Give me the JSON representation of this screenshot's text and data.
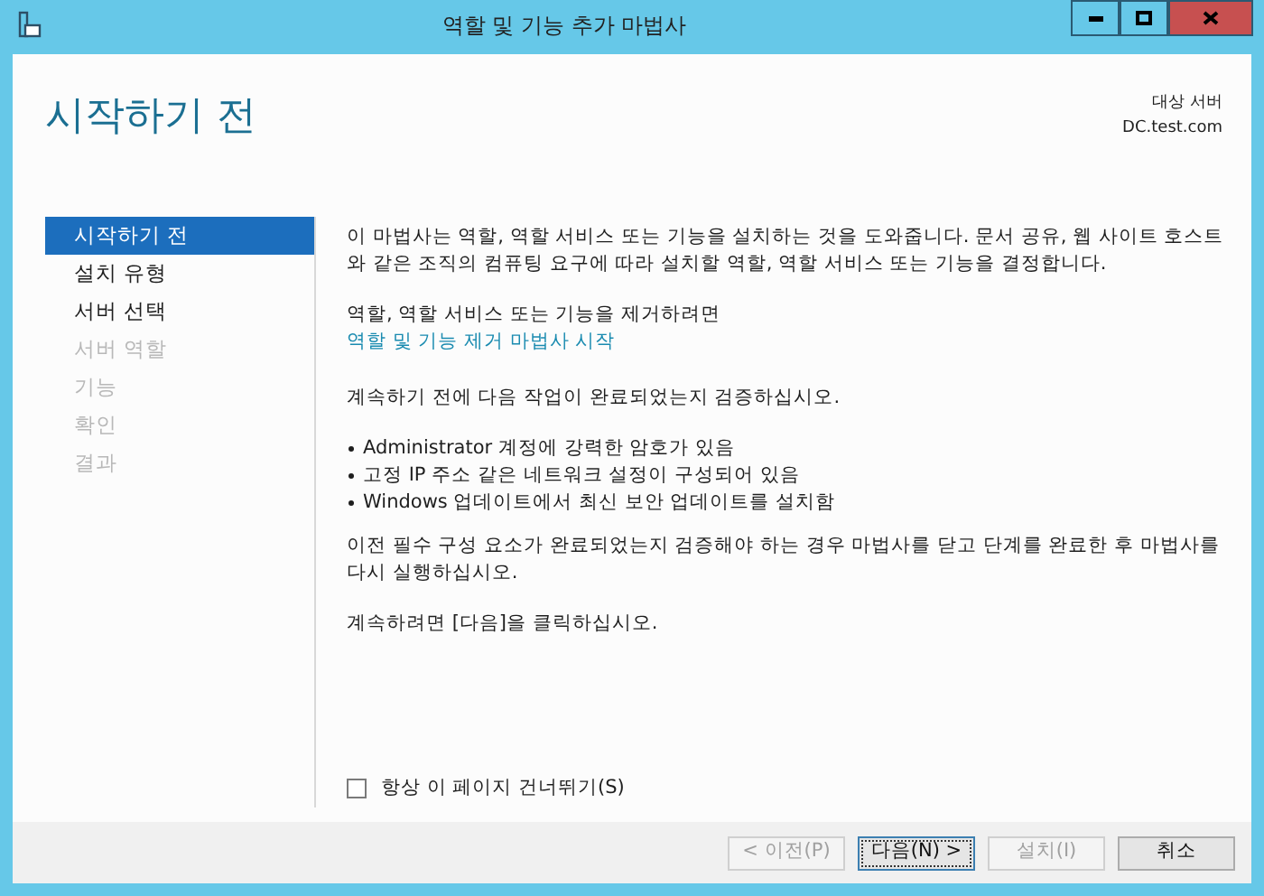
{
  "window": {
    "title": "역할 및 기능 추가 마법사"
  },
  "header": {
    "title": "시작하기 전",
    "target_label": "대상 서버",
    "target_server": "DC.test.com"
  },
  "steps": [
    {
      "label": "시작하기 전",
      "selected": true,
      "disabled": false
    },
    {
      "label": "설치 유형",
      "selected": false,
      "disabled": false
    },
    {
      "label": "서버 선택",
      "selected": false,
      "disabled": false
    },
    {
      "label": "서버 역할",
      "selected": false,
      "disabled": true
    },
    {
      "label": "기능",
      "selected": false,
      "disabled": true
    },
    {
      "label": "확인",
      "selected": false,
      "disabled": true
    },
    {
      "label": "결과",
      "selected": false,
      "disabled": true
    }
  ],
  "content": [
    {
      "kind": "paragraph",
      "text": "이 마법사는 역할, 역할 서비스 또는 기능을 설치하는 것을 도와줍니다. 문서 공유, 웹 사이트 호스트와 같은 조직의 컴퓨팅 요구에 따라 설치할 역할, 역할 서비스 또는 기능을 결정합니다."
    },
    {
      "kind": "paragraph_with_link",
      "text": "역할, 역할 서비스 또는 기능을 제거하려면",
      "link": "역할 및 기능 제거 마법사 시작"
    },
    {
      "kind": "paragraph",
      "text": "계속하기 전에 다음 작업이 완료되었는지 검증하십시오."
    },
    {
      "kind": "bullets",
      "items": [
        "Administrator 계정에 강력한 암호가 있음",
        "고정 IP 주소 같은 네트워크 설정이 구성되어 있음",
        "Windows 업데이트에서 최신 보안 업데이트를 설치함"
      ]
    },
    {
      "kind": "paragraph",
      "text": "이전 필수 구성 요소가 완료되었는지 검증해야 하는 경우 마법사를 닫고 단계를 완료한 후 마법사를 다시 실행하십시오."
    },
    {
      "kind": "paragraph",
      "text": "계속하려면 [다음]을 클릭하십시오."
    }
  ],
  "skip_checkbox": {
    "label": "항상 이 페이지 건너뛰기(S)",
    "checked": false
  },
  "buttons": [
    {
      "label": "< 이전(P)",
      "disabled": true,
      "default": false
    },
    {
      "label": "다음(N) >",
      "disabled": false,
      "default": true
    },
    {
      "label": "설치(I)",
      "disabled": true,
      "default": false
    },
    {
      "label": "취소",
      "disabled": false,
      "default": false
    }
  ]
}
